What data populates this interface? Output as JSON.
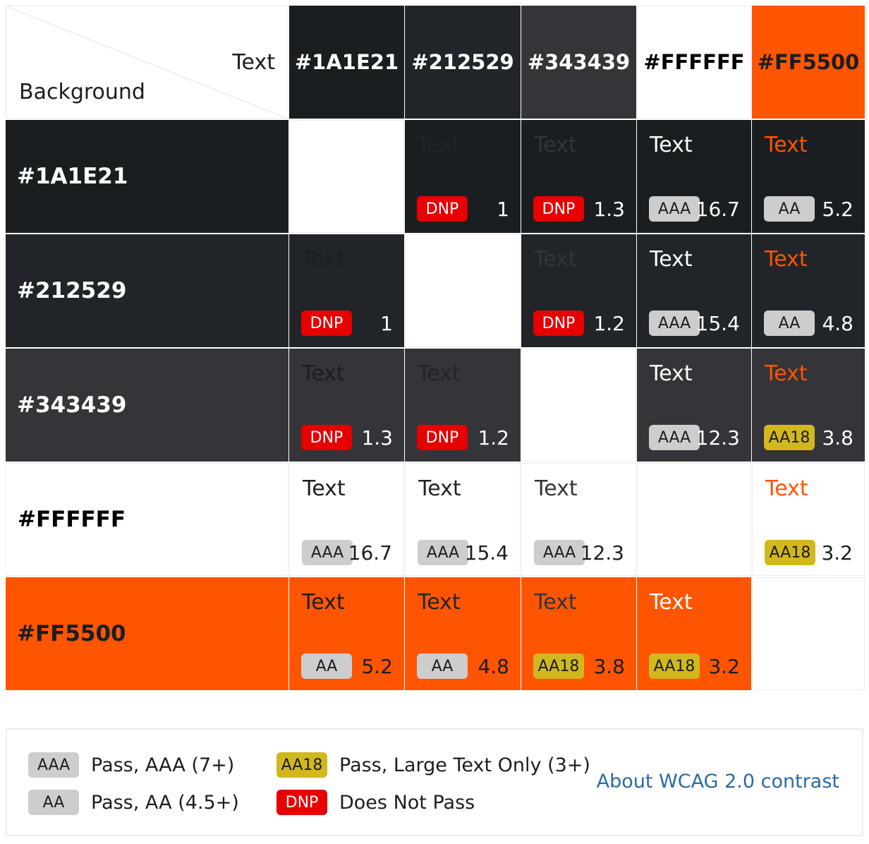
{
  "corner": {
    "text_label": "Text",
    "background_label": "Background"
  },
  "colors": [
    "#1A1E21",
    "#212529",
    "#343439",
    "#FFFFFF",
    "#FF5500"
  ],
  "color_swatches": [
    "#1a1e21",
    "#212529",
    "#343439",
    "#ffffff",
    "#ff5500"
  ],
  "header_text_colors": [
    "#ffffff",
    "#ffffff",
    "#ffffff",
    "#000000",
    "#1a1e21"
  ],
  "row_text_colors": [
    "#ffffff",
    "#ffffff",
    "#ffffff",
    "#000000",
    "#1a1e21"
  ],
  "sample_text": "Text",
  "matrix": [
    [
      null,
      {
        "badge": "DNP",
        "ratio": "1"
      },
      {
        "badge": "DNP",
        "ratio": "1.3"
      },
      {
        "badge": "AAA",
        "ratio": "16.7"
      },
      {
        "badge": "AA",
        "ratio": "5.2"
      }
    ],
    [
      {
        "badge": "DNP",
        "ratio": "1"
      },
      null,
      {
        "badge": "DNP",
        "ratio": "1.2"
      },
      {
        "badge": "AAA",
        "ratio": "15.4"
      },
      {
        "badge": "AA",
        "ratio": "4.8"
      }
    ],
    [
      {
        "badge": "DNP",
        "ratio": "1.3"
      },
      {
        "badge": "DNP",
        "ratio": "1.2"
      },
      null,
      {
        "badge": "AAA",
        "ratio": "12.3"
      },
      {
        "badge": "AA18",
        "ratio": "3.8"
      }
    ],
    [
      {
        "badge": "AAA",
        "ratio": "16.7"
      },
      {
        "badge": "AAA",
        "ratio": "15.4"
      },
      {
        "badge": "AAA",
        "ratio": "12.3"
      },
      null,
      {
        "badge": "AA18",
        "ratio": "3.2"
      }
    ],
    [
      {
        "badge": "AA",
        "ratio": "5.2"
      },
      {
        "badge": "AA",
        "ratio": "4.8"
      },
      {
        "badge": "AA18",
        "ratio": "3.8"
      },
      {
        "badge": "AA18",
        "ratio": "3.2"
      },
      null
    ]
  ],
  "legend": {
    "items": [
      {
        "badge": "AAA",
        "text": "Pass, AAA (7+)"
      },
      {
        "badge": "AA",
        "text": "Pass, AA (4.5+)"
      },
      {
        "badge": "AA18",
        "text": "Pass, Large Text Only (3+)"
      },
      {
        "badge": "DNP",
        "text": "Does Not Pass"
      }
    ],
    "link_text": "About WCAG 2.0 contrast"
  }
}
